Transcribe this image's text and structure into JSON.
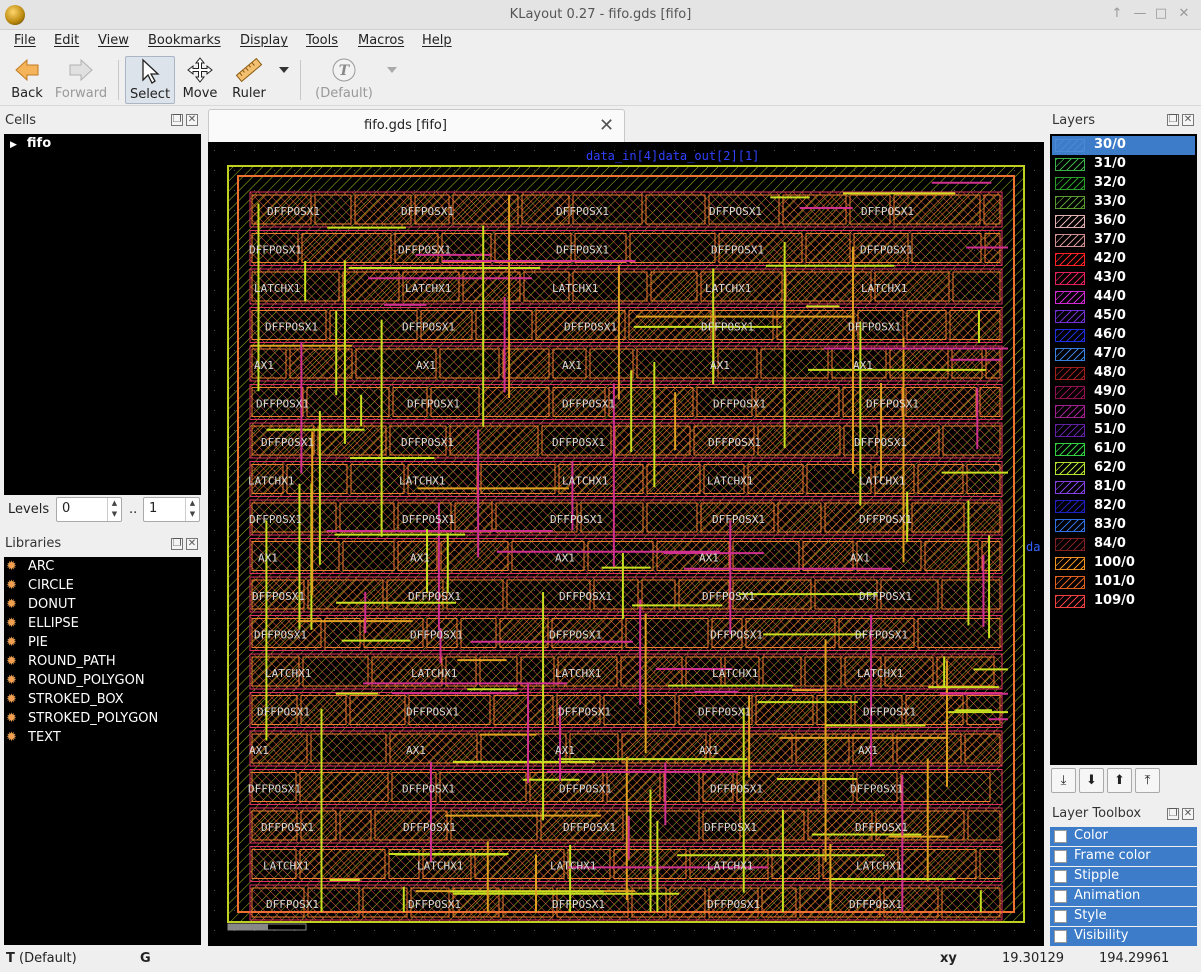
{
  "window": {
    "title": "KLayout 0.27 - fifo.gds [fifo]",
    "controls": [
      "↑",
      "—",
      "□",
      "✕"
    ]
  },
  "menu": [
    "File",
    "Edit",
    "View",
    "Bookmarks",
    "Display",
    "Tools",
    "Macros",
    "Help"
  ],
  "toolbar": {
    "back": "Back",
    "forward": "Forward",
    "select": "Select",
    "move": "Move",
    "ruler": "Ruler",
    "text_default": "(Default)"
  },
  "cells": {
    "title": "Cells",
    "root": "fifo",
    "levels_label": "Levels",
    "level_from": "0",
    "level_sep": "..",
    "level_to": "1"
  },
  "libraries": {
    "title": "Libraries",
    "items": [
      "ARC",
      "CIRCLE",
      "DONUT",
      "ELLIPSE",
      "PIE",
      "ROUND_PATH",
      "ROUND_POLYGON",
      "STROKED_BOX",
      "STROKED_POLYGON",
      "TEXT"
    ]
  },
  "tab": {
    "label": "fifo.gds [fifo]",
    "close_icon": "✕"
  },
  "canvas": {
    "top_labels": "data_in[4]data_out[2][1]",
    "right_label": "da",
    "cell_label": "DFFPOSX1",
    "latch_label": "LATCHX1",
    "ax_label": "AX1"
  },
  "layers": {
    "title": "Layers",
    "items": [
      {
        "name": "30/0",
        "color": "#4a88d8",
        "selected": true
      },
      {
        "name": "31/0",
        "color": "#3cb04a"
      },
      {
        "name": "32/0",
        "color": "#2aa02a"
      },
      {
        "name": "33/0",
        "color": "#5a9a30"
      },
      {
        "name": "36/0",
        "color": "#e0b0b0"
      },
      {
        "name": "37/0",
        "color": "#d09090"
      },
      {
        "name": "42/0",
        "color": "#ff2222"
      },
      {
        "name": "43/0",
        "color": "#e0205a"
      },
      {
        "name": "44/0",
        "color": "#d028d0"
      },
      {
        "name": "45/0",
        "color": "#7030d0"
      },
      {
        "name": "46/0",
        "color": "#2030e0"
      },
      {
        "name": "47/0",
        "color": "#3a80e0"
      },
      {
        "name": "48/0",
        "color": "#a02020"
      },
      {
        "name": "49/0",
        "color": "#901050"
      },
      {
        "name": "50/0",
        "color": "#a02090"
      },
      {
        "name": "51/0",
        "color": "#6020a0"
      },
      {
        "name": "61/0",
        "color": "#30d040"
      },
      {
        "name": "62/0",
        "color": "#b0e030"
      },
      {
        "name": "81/0",
        "color": "#8040e0"
      },
      {
        "name": "82/0",
        "color": "#2020c0"
      },
      {
        "name": "83/0",
        "color": "#3070e0"
      },
      {
        "name": "84/0",
        "color": "#802020"
      },
      {
        "name": "100/0",
        "color": "#f09020"
      },
      {
        "name": "101/0",
        "color": "#e06020"
      },
      {
        "name": "109/0",
        "color": "#f04040"
      }
    ]
  },
  "layer_toolbox": {
    "title": "Layer Toolbox",
    "items": [
      "Color",
      "Frame color",
      "Stipple",
      "Animation",
      "Style",
      "Visibility"
    ]
  },
  "status": {
    "tool": "(Default)",
    "tool_prefix": "T",
    "grid": "G",
    "xy_label": "xy",
    "x": "19.30129",
    "y": "194.29961"
  }
}
